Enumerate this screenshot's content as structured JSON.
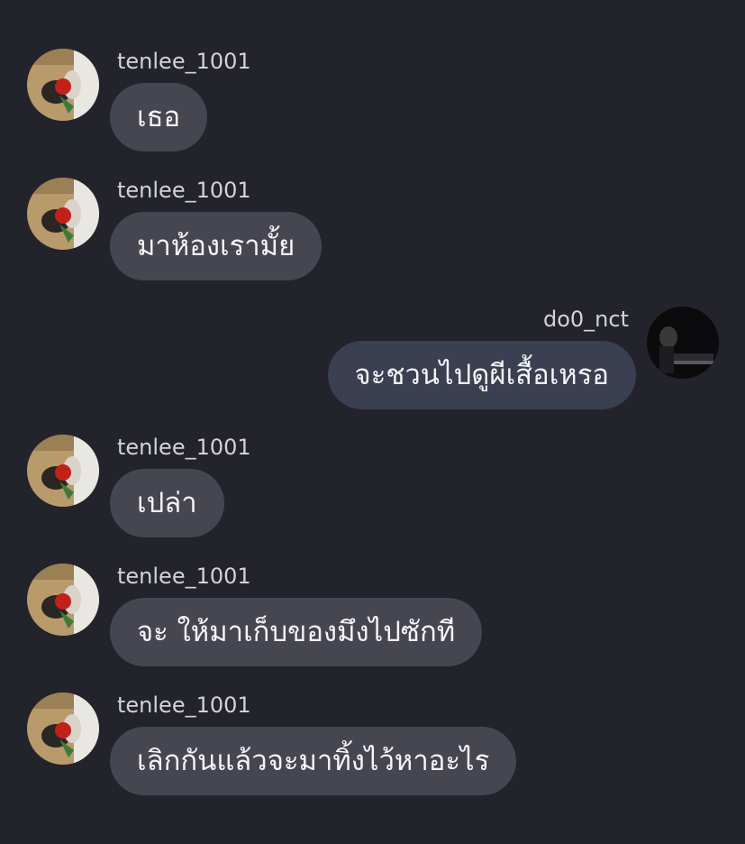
{
  "messages": [
    {
      "sender": "tenlee_1001",
      "side": "left",
      "text": "เธอ",
      "avatar": "rose-avatar-icon"
    },
    {
      "sender": "tenlee_1001",
      "side": "left",
      "text": "มาห้องเรามั้ย",
      "avatar": "rose-avatar-icon"
    },
    {
      "sender": "do0_nct",
      "side": "right",
      "text": "จะชวนไปดูผีเสื้อเหรอ",
      "avatar": "piano-avatar-icon"
    },
    {
      "sender": "tenlee_1001",
      "side": "left",
      "text": "เปล่า",
      "avatar": "rose-avatar-icon"
    },
    {
      "sender": "tenlee_1001",
      "side": "left",
      "text": "จะ ให้มาเก็บของมึงไปซักที",
      "avatar": "rose-avatar-icon"
    },
    {
      "sender": "tenlee_1001",
      "side": "left",
      "text": "เลิกกันแล้วจะมาทิ้งไว้หาอะไร",
      "avatar": "rose-avatar-icon"
    }
  ],
  "colors": {
    "background": "#23232b",
    "incoming_bubble": "#464651",
    "outgoing_bubble": "#3a3f51",
    "username_text": "#d2d2d8",
    "message_text": "#f4f4f6"
  }
}
